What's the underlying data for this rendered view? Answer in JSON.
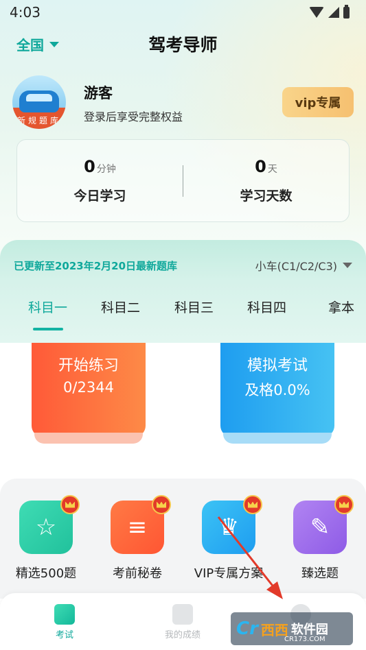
{
  "status_bar": {
    "time": "4:03"
  },
  "header": {
    "region": "全国",
    "title": "驾考导师"
  },
  "profile": {
    "avatar_label": "新规题库",
    "name": "游客",
    "hint": "登录后享受完整权益",
    "vip_label": "vip专属"
  },
  "stats": [
    {
      "value": "0",
      "unit": "分钟",
      "label": "今日学习"
    },
    {
      "value": "0",
      "unit": "天",
      "label": "学习天数"
    }
  ],
  "exam": {
    "update_text": "已更新至2023年2月20日最新题库",
    "car_type": "小车(C1/C2/C3)",
    "tabs": [
      "科目一",
      "科目二",
      "科目三",
      "科目四",
      "拿本"
    ],
    "active_tab": 0
  },
  "cards": {
    "practice": {
      "title": "开始练习",
      "sub": "0/2344"
    },
    "mock": {
      "title": "模拟考试",
      "sub": "及格0.0%"
    }
  },
  "features": [
    {
      "label": "精选500题",
      "icon": "star-icon",
      "color": "#2fcfab"
    },
    {
      "label": "考前秘卷",
      "icon": "scroll-icon",
      "color": "#ff6b3d"
    },
    {
      "label": "VIP专属方案",
      "icon": "crown-icon",
      "color": "#2aa9f0"
    },
    {
      "label": "臻选题",
      "icon": "pen-icon",
      "color": "#9b6bea"
    }
  ],
  "bottom_nav": [
    {
      "label": "考试",
      "active": true
    },
    {
      "label": "我的成绩",
      "active": false
    }
  ],
  "watermark": {
    "logo": "Cr",
    "brand": "西西",
    "suffix": "软件园",
    "url": "CR173.COM"
  },
  "colors": {
    "accent": "#0fa89b",
    "vip": "#f7c77a",
    "practice": "#ff5a38",
    "mock": "#1e9df0",
    "arrow": "#e23a2a"
  }
}
